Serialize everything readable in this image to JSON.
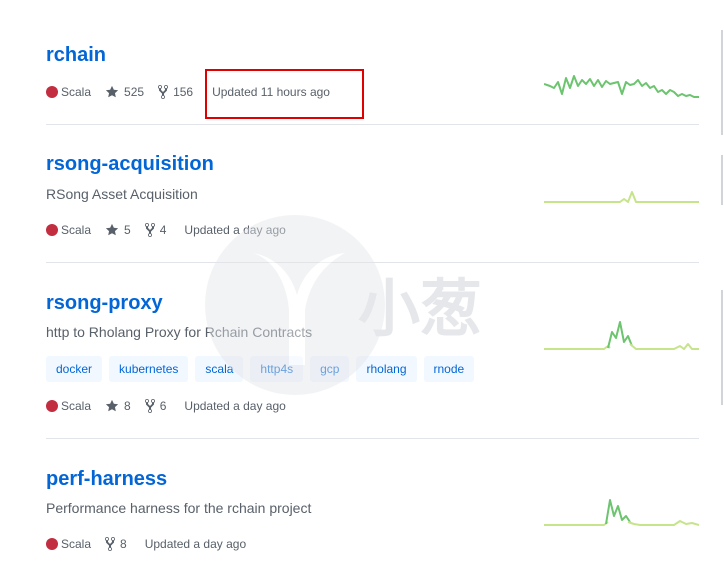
{
  "repos": [
    {
      "name": "rchain",
      "description": "",
      "language": "Scala",
      "stars": "525",
      "forks": "156",
      "updated": "Updated 11 hours ago",
      "topics": []
    },
    {
      "name": "rsong-acquisition",
      "description": "RSong Asset Acquisition",
      "language": "Scala",
      "stars": "5",
      "forks": "4",
      "updated": "Updated a day ago",
      "topics": []
    },
    {
      "name": "rsong-proxy",
      "description": "http to Rholang Proxy for Rchain Contracts",
      "language": "Scala",
      "stars": "8",
      "forks": "6",
      "updated": "Updated a day ago",
      "topics": [
        "docker",
        "kubernetes",
        "scala",
        "http4s",
        "gcp",
        "rholang",
        "rnode"
      ]
    },
    {
      "name": "perf-harness",
      "description": "Performance harness for the rchain project",
      "language": "Scala",
      "stars": "",
      "forks": "8",
      "updated": "Updated a day ago",
      "topics": []
    }
  ],
  "colors": {
    "link": "#0366d6",
    "scala": "#c22d40",
    "spark_dark": "#6cc46f",
    "spark_light": "#c6e48b",
    "highlight": "#e00000"
  },
  "watermark": {
    "text": "小葱"
  }
}
